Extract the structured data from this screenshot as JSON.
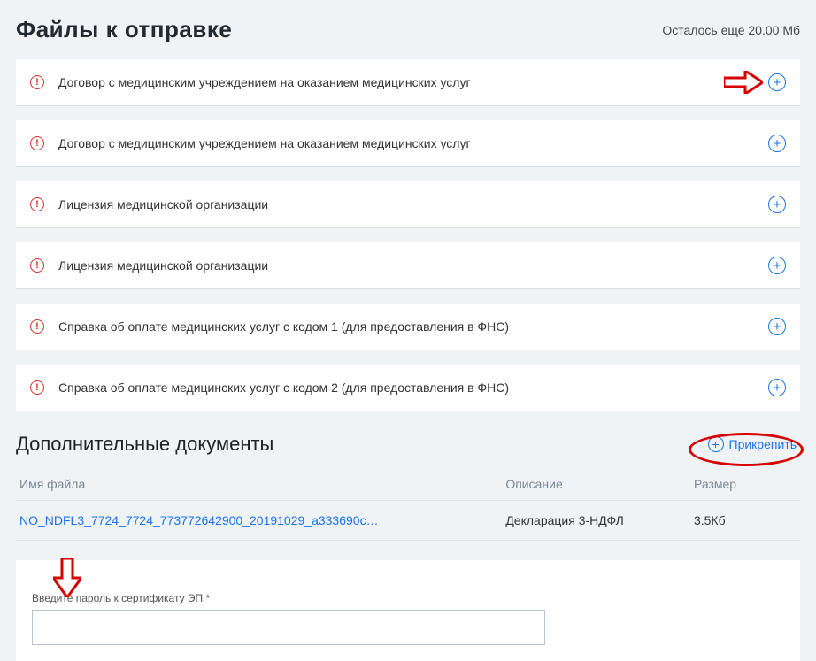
{
  "header": {
    "title": "Файлы к отправке",
    "remaining": "Осталось еще 20.00 Мб"
  },
  "files": [
    {
      "label": "Договор с медицинским учреждением на оказанием медицинских услуг"
    },
    {
      "label": "Договор с медицинским учреждением на оказанием медицинских услуг"
    },
    {
      "label": "Лицензия медицинской организации"
    },
    {
      "label": "Лицензия медицинской организации"
    },
    {
      "label": "Справка об оплате медицинских услуг с кодом 1 (для предоставления в ФНС)"
    },
    {
      "label": "Справка об оплате медицинских услуг с кодом 2 (для предоставления в ФНС)"
    }
  ],
  "additional": {
    "title": "Дополнительные документы",
    "attach_label": "Прикрепить",
    "columns": {
      "name": "Имя файла",
      "desc": "Описание",
      "size": "Размер"
    },
    "rows": [
      {
        "name": "NO_NDFL3_7724_7724_773772642900_20191029_a333690c…",
        "desc": "Декларация 3-НДФЛ",
        "size": "3.5Кб"
      }
    ]
  },
  "password": {
    "label": "Введите пароль к сертификату ЭП *",
    "value": ""
  }
}
